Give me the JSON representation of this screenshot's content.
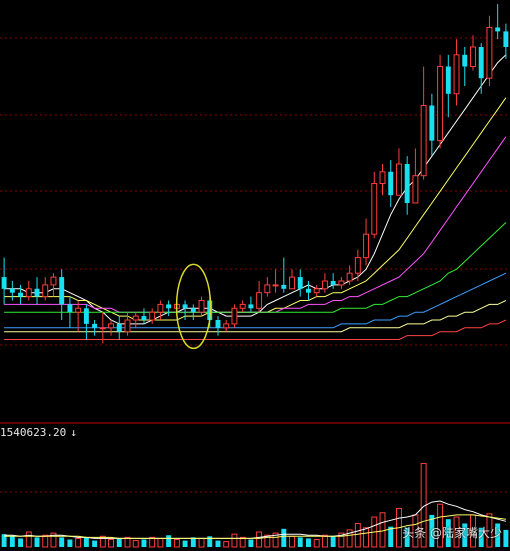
{
  "volume_readout": "1540623.20",
  "watermark": "头条 @陆家嘴大少",
  "colors": {
    "up": "#ff3d3d",
    "down": "#19e0f0",
    "grid": "#8a0000",
    "divider": "#c00000",
    "ellipse": "#d9d92a",
    "background": "#000000"
  },
  "chart_data": {
    "type": "candlestick",
    "title": "",
    "grid": true,
    "n_bars": 62,
    "price_range": [
      0,
      100
    ],
    "volume_range": [
      0,
      100
    ],
    "candles": [
      [
        31,
        28,
        36,
        24
      ],
      [
        28,
        27,
        30,
        25
      ],
      [
        27,
        26,
        29,
        24
      ],
      [
        26,
        28,
        30,
        25
      ],
      [
        28,
        26,
        31,
        24
      ],
      [
        26,
        29,
        31,
        25
      ],
      [
        29,
        31,
        32,
        26
      ],
      [
        31,
        24,
        33,
        20
      ],
      [
        24,
        22,
        26,
        18
      ],
      [
        22,
        23,
        25,
        17
      ],
      [
        23,
        19,
        24,
        15
      ],
      [
        19,
        18,
        20,
        16
      ],
      [
        18,
        18,
        22,
        14
      ],
      [
        18,
        19,
        20,
        16
      ],
      [
        19,
        17,
        21,
        15
      ],
      [
        17,
        20,
        22,
        16
      ],
      [
        20,
        21,
        22,
        18
      ],
      [
        21,
        20,
        23,
        19
      ],
      [
        20,
        22,
        23,
        19
      ],
      [
        22,
        24,
        25,
        20
      ],
      [
        24,
        23,
        25,
        21
      ],
      [
        23,
        24,
        26,
        22
      ],
      [
        24,
        23,
        25,
        20
      ],
      [
        23,
        22,
        24,
        20
      ],
      [
        22,
        25,
        26,
        21
      ],
      [
        25,
        20,
        26,
        18
      ],
      [
        20,
        18,
        21,
        16
      ],
      [
        18,
        19,
        20,
        17
      ],
      [
        19,
        23,
        24,
        18
      ],
      [
        23,
        24,
        25,
        22
      ],
      [
        24,
        23,
        26,
        22
      ],
      [
        23,
        27,
        30,
        22
      ],
      [
        27,
        29,
        31,
        26
      ],
      [
        29,
        29,
        33,
        27
      ],
      [
        29,
        28,
        36,
        27
      ],
      [
        28,
        31,
        33,
        28
      ],
      [
        31,
        28,
        33,
        26
      ],
      [
        28,
        27,
        30,
        25
      ],
      [
        27,
        28,
        29,
        26
      ],
      [
        28,
        30,
        32,
        27
      ],
      [
        30,
        29,
        32,
        28
      ],
      [
        29,
        30,
        31,
        28
      ],
      [
        30,
        32,
        34,
        29
      ],
      [
        32,
        36,
        38,
        30
      ],
      [
        36,
        42,
        46,
        34
      ],
      [
        42,
        55,
        58,
        41
      ],
      [
        55,
        58,
        60,
        52
      ],
      [
        58,
        52,
        61,
        49
      ],
      [
        52,
        60,
        64,
        52
      ],
      [
        60,
        50,
        62,
        47
      ],
      [
        50,
        57,
        64,
        50
      ],
      [
        57,
        75,
        85,
        56
      ],
      [
        75,
        66,
        78,
        62
      ],
      [
        66,
        85,
        88,
        64
      ],
      [
        85,
        78,
        88,
        72
      ],
      [
        78,
        88,
        92,
        75
      ],
      [
        88,
        85,
        90,
        80
      ],
      [
        85,
        90,
        93,
        84
      ],
      [
        90,
        82,
        91,
        78
      ],
      [
        82,
        95,
        98,
        80
      ],
      [
        95,
        94,
        101,
        92
      ],
      [
        94,
        90,
        96,
        87
      ]
    ],
    "volume": [
      12,
      10,
      8,
      14,
      9,
      11,
      13,
      9,
      7,
      8,
      9,
      6,
      10,
      7,
      8,
      9,
      6,
      7,
      9,
      8,
      11,
      7,
      6,
      9,
      8,
      10,
      6,
      5,
      12,
      9,
      7,
      14,
      11,
      13,
      17,
      10,
      9,
      8,
      7,
      11,
      10,
      13,
      16,
      22,
      18,
      28,
      32,
      19,
      36,
      18,
      30,
      78,
      30,
      40,
      26,
      28,
      22,
      30,
      18,
      31,
      22,
      16
    ],
    "ma_lines": [
      {
        "color": "#ffffff",
        "values": [
          28,
          28,
          28,
          27,
          27,
          27,
          28,
          28,
          27,
          26,
          25,
          23,
          22,
          20,
          19,
          19,
          19,
          19,
          20,
          21,
          22,
          22,
          23,
          23,
          23,
          23,
          22,
          21,
          21,
          21,
          21,
          22,
          24,
          25,
          26,
          27,
          28,
          29,
          28,
          28,
          29,
          29,
          30,
          31,
          33,
          37,
          42,
          47,
          51,
          54,
          56,
          59,
          62,
          65,
          68,
          71,
          74,
          77,
          80,
          83,
          86,
          88
        ]
      },
      {
        "color": "#ffff66",
        "values": [
          26,
          26,
          26,
          26,
          26,
          26,
          26,
          26,
          26,
          25,
          25,
          24,
          23,
          22,
          21,
          21,
          20,
          20,
          20,
          20,
          20,
          20,
          21,
          21,
          21,
          22,
          22,
          22,
          22,
          22,
          22,
          22,
          22,
          23,
          23,
          24,
          25,
          25,
          26,
          26,
          27,
          27,
          28,
          29,
          30,
          32,
          34,
          36,
          38,
          41,
          44,
          47,
          50,
          53,
          56,
          59,
          62,
          65,
          68,
          71,
          74,
          77
        ]
      },
      {
        "color": "#ff55ff",
        "values": [
          24,
          24,
          24,
          24,
          24,
          24,
          24,
          24,
          24,
          24,
          24,
          23,
          23,
          23,
          22,
          22,
          22,
          22,
          22,
          22,
          22,
          22,
          22,
          22,
          22,
          22,
          22,
          22,
          22,
          22,
          22,
          22,
          22,
          22,
          23,
          23,
          23,
          24,
          24,
          24,
          25,
          25,
          26,
          26,
          27,
          28,
          29,
          30,
          31,
          33,
          35,
          37,
          40,
          43,
          46,
          49,
          52,
          55,
          58,
          61,
          64,
          67
        ]
      },
      {
        "color": "#33ee33",
        "values": [
          22,
          22,
          22,
          22,
          22,
          22,
          22,
          22,
          22,
          22,
          22,
          22,
          22,
          22,
          22,
          22,
          22,
          22,
          22,
          22,
          22,
          22,
          22,
          22,
          22,
          22,
          22,
          22,
          22,
          22,
          22,
          22,
          22,
          22,
          22,
          22,
          22,
          22,
          22,
          22,
          22,
          23,
          23,
          23,
          23,
          24,
          24,
          25,
          26,
          26,
          27,
          28,
          29,
          30,
          32,
          33,
          35,
          37,
          39,
          41,
          43,
          45
        ]
      },
      {
        "color": "#3aa0ff",
        "values": [
          18,
          18,
          18,
          18,
          18,
          18,
          18,
          18,
          18,
          18,
          18,
          18,
          18,
          18,
          18,
          18,
          18,
          18,
          18,
          18,
          18,
          18,
          18,
          18,
          18,
          18,
          18,
          18,
          18,
          18,
          18,
          18,
          18,
          18,
          18,
          18,
          18,
          18,
          18,
          18,
          18,
          19,
          19,
          19,
          19,
          20,
          20,
          20,
          21,
          21,
          22,
          22,
          23,
          24,
          25,
          26,
          27,
          28,
          29,
          30,
          31,
          32
        ]
      },
      {
        "color": "#ffff99",
        "values": [
          17,
          17,
          17,
          17,
          17,
          17,
          17,
          17,
          17,
          17,
          17,
          17,
          17,
          17,
          17,
          17,
          17,
          17,
          17,
          17,
          17,
          17,
          17,
          17,
          17,
          17,
          17,
          17,
          17,
          17,
          17,
          17,
          17,
          17,
          17,
          17,
          17,
          17,
          17,
          17,
          17,
          17,
          18,
          18,
          18,
          18,
          18,
          18,
          18,
          19,
          19,
          19,
          20,
          20,
          21,
          21,
          22,
          22,
          23,
          24,
          24,
          25
        ]
      },
      {
        "color": "#ff4444",
        "values": [
          15,
          15,
          15,
          15,
          15,
          15,
          15,
          15,
          15,
          15,
          15,
          15,
          15,
          15,
          15,
          15,
          15,
          15,
          15,
          15,
          15,
          15,
          15,
          15,
          15,
          15,
          15,
          15,
          15,
          15,
          15,
          15,
          15,
          15,
          15,
          15,
          15,
          15,
          15,
          15,
          15,
          15,
          15,
          15,
          15,
          15,
          15,
          15,
          15,
          16,
          16,
          16,
          16,
          17,
          17,
          17,
          18,
          18,
          18,
          19,
          19,
          20
        ]
      }
    ],
    "volume_ma": [
      {
        "color": "#ffffff",
        "values": [
          11,
          11,
          10,
          11,
          10,
          10,
          11,
          11,
          10,
          9,
          9,
          8,
          8,
          8,
          8,
          8,
          8,
          8,
          8,
          8,
          8,
          8,
          8,
          8,
          8,
          8,
          8,
          8,
          8,
          8,
          8,
          9,
          10,
          11,
          12,
          12,
          12,
          11,
          11,
          10,
          10,
          11,
          13,
          15,
          17,
          20,
          23,
          25,
          27,
          28,
          30,
          38,
          42,
          43,
          40,
          38,
          35,
          33,
          30,
          28,
          26,
          24
        ]
      },
      {
        "color": "#ffff66",
        "values": [
          10,
          10,
          10,
          10,
          10,
          10,
          10,
          10,
          10,
          10,
          9,
          9,
          9,
          9,
          8,
          8,
          8,
          8,
          8,
          8,
          8,
          8,
          8,
          8,
          8,
          8,
          8,
          8,
          8,
          8,
          8,
          8,
          9,
          9,
          10,
          10,
          10,
          10,
          10,
          10,
          10,
          10,
          11,
          12,
          13,
          14,
          15,
          17,
          18,
          20,
          21,
          24,
          26,
          28,
          29,
          30,
          30,
          30,
          29,
          28,
          27,
          26
        ]
      }
    ],
    "highlight": {
      "shape": "ellipse",
      "bar_index": 24
    }
  }
}
